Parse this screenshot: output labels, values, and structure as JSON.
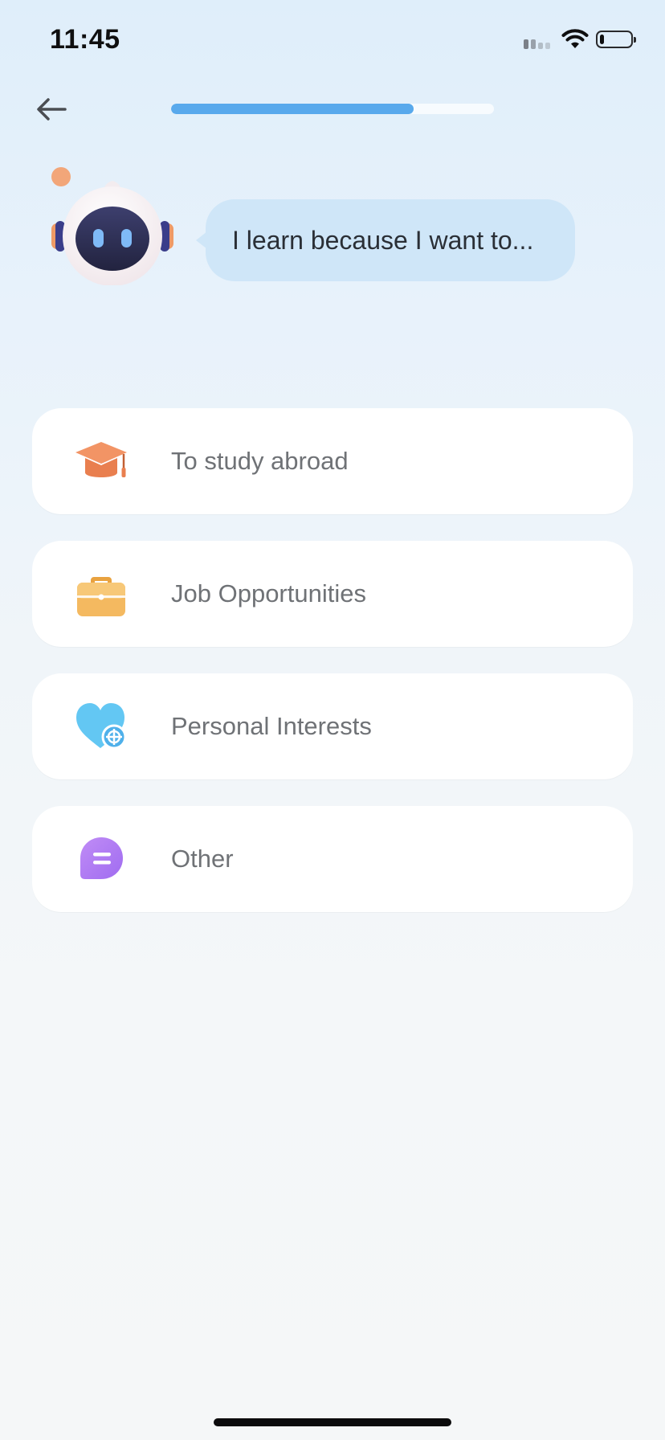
{
  "status_bar": {
    "time": "11:45",
    "battery_level": 0.25
  },
  "header": {
    "back_icon": "arrow-left-icon",
    "progress": 0.75
  },
  "prompt": {
    "mascot": "robot-mascot",
    "text": "I learn because I want to..."
  },
  "options": [
    {
      "label": "To study abroad",
      "icon": "graduation-cap-icon",
      "color": "#ee8a5b"
    },
    {
      "label": "Job Opportunities",
      "icon": "briefcase-icon",
      "color": "#f3b55a"
    },
    {
      "label": "Personal Interests",
      "icon": "heart-icon",
      "color": "#5ec6f2"
    },
    {
      "label": "Other",
      "icon": "chat-bubble-icon",
      "color": "#b57ff2"
    }
  ],
  "colors": {
    "accent": "#58a9ec",
    "bubble": "#cfe6f8"
  }
}
